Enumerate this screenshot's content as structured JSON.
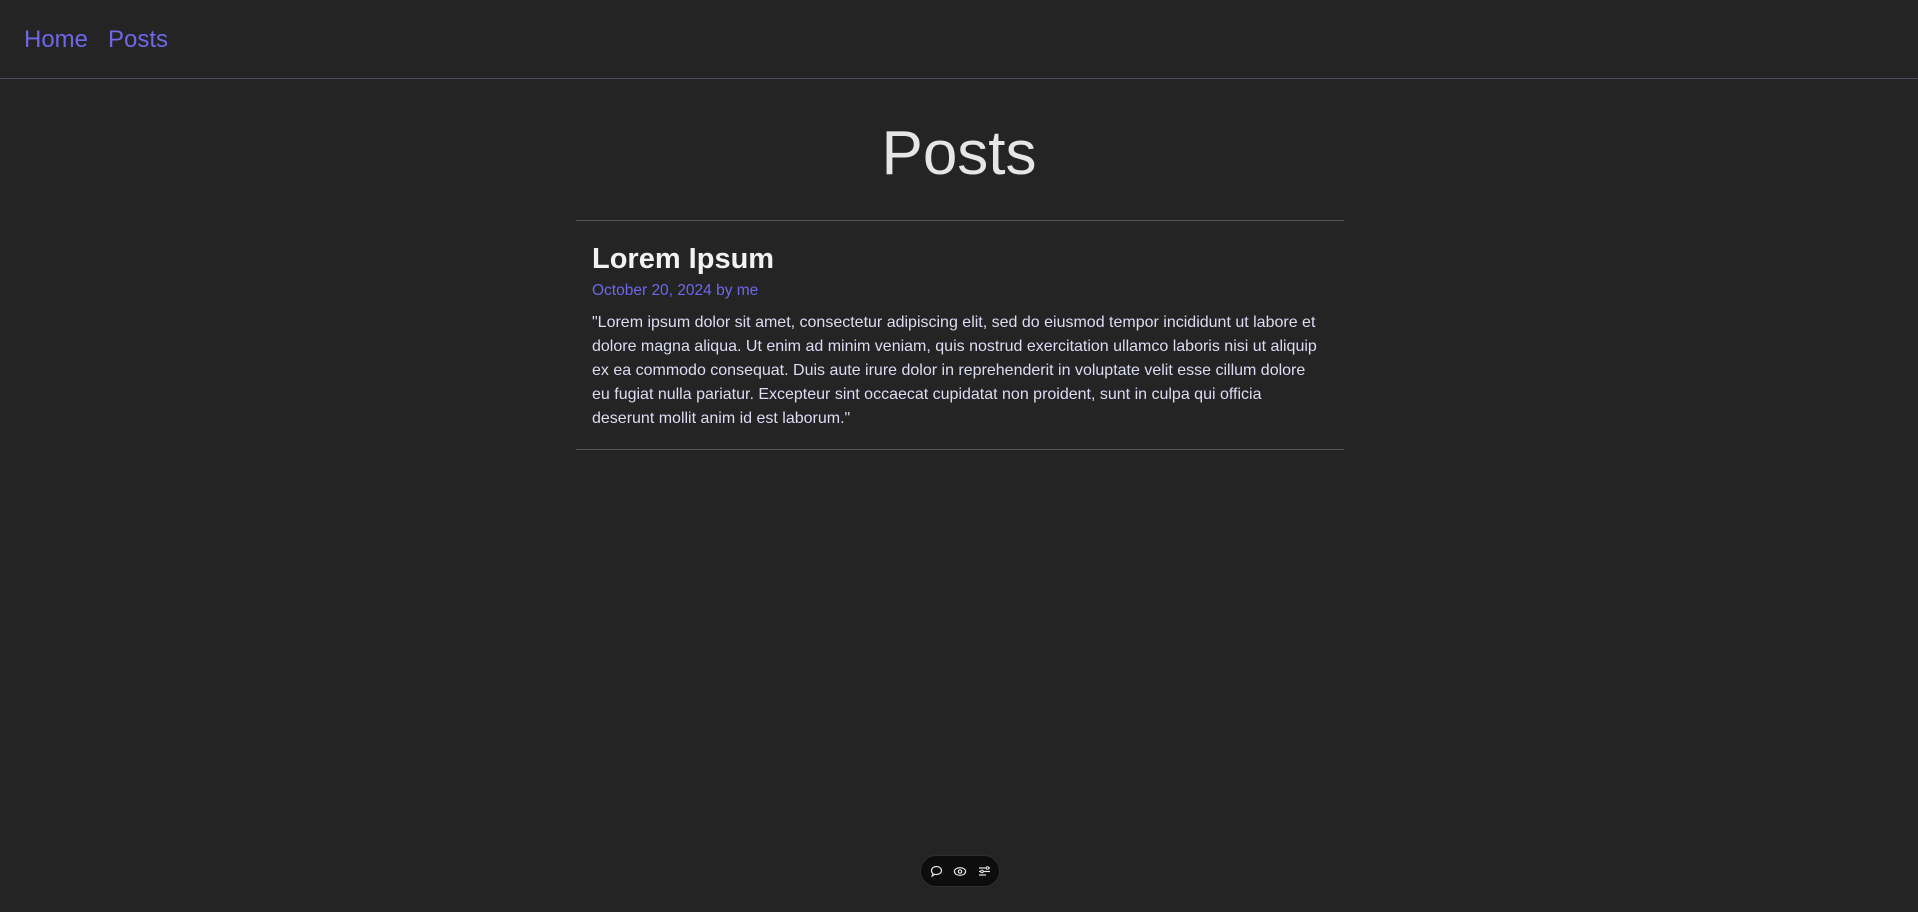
{
  "nav": {
    "home_label": "Home",
    "posts_label": "Posts"
  },
  "page": {
    "title": "Posts"
  },
  "posts": [
    {
      "title": "Lorem Ipsum",
      "meta": "October 20, 2024 by me",
      "body": "\"Lorem ipsum dolor sit amet, consectetur adipiscing elit, sed do eiusmod tempor incididunt ut labore et dolore magna aliqua. Ut enim ad minim veniam, quis nostrud exercitation ullamco laboris nisi ut aliquip ex ea commodo consequat. Duis aute irure dolor in reprehenderit in voluptate velit esse cillum dolore eu fugiat nulla pariatur. Excepteur sint occaecat cupidatat non proident, sunt in culpa qui officia deserunt mollit anim id est laborum.\""
    }
  ],
  "toolbar": {
    "icons": [
      "comment-icon",
      "eye-icon",
      "settings-sliders-icon"
    ]
  },
  "colors": {
    "background": "#242424",
    "accent": "#6f67e8",
    "divider": "#54545c"
  }
}
